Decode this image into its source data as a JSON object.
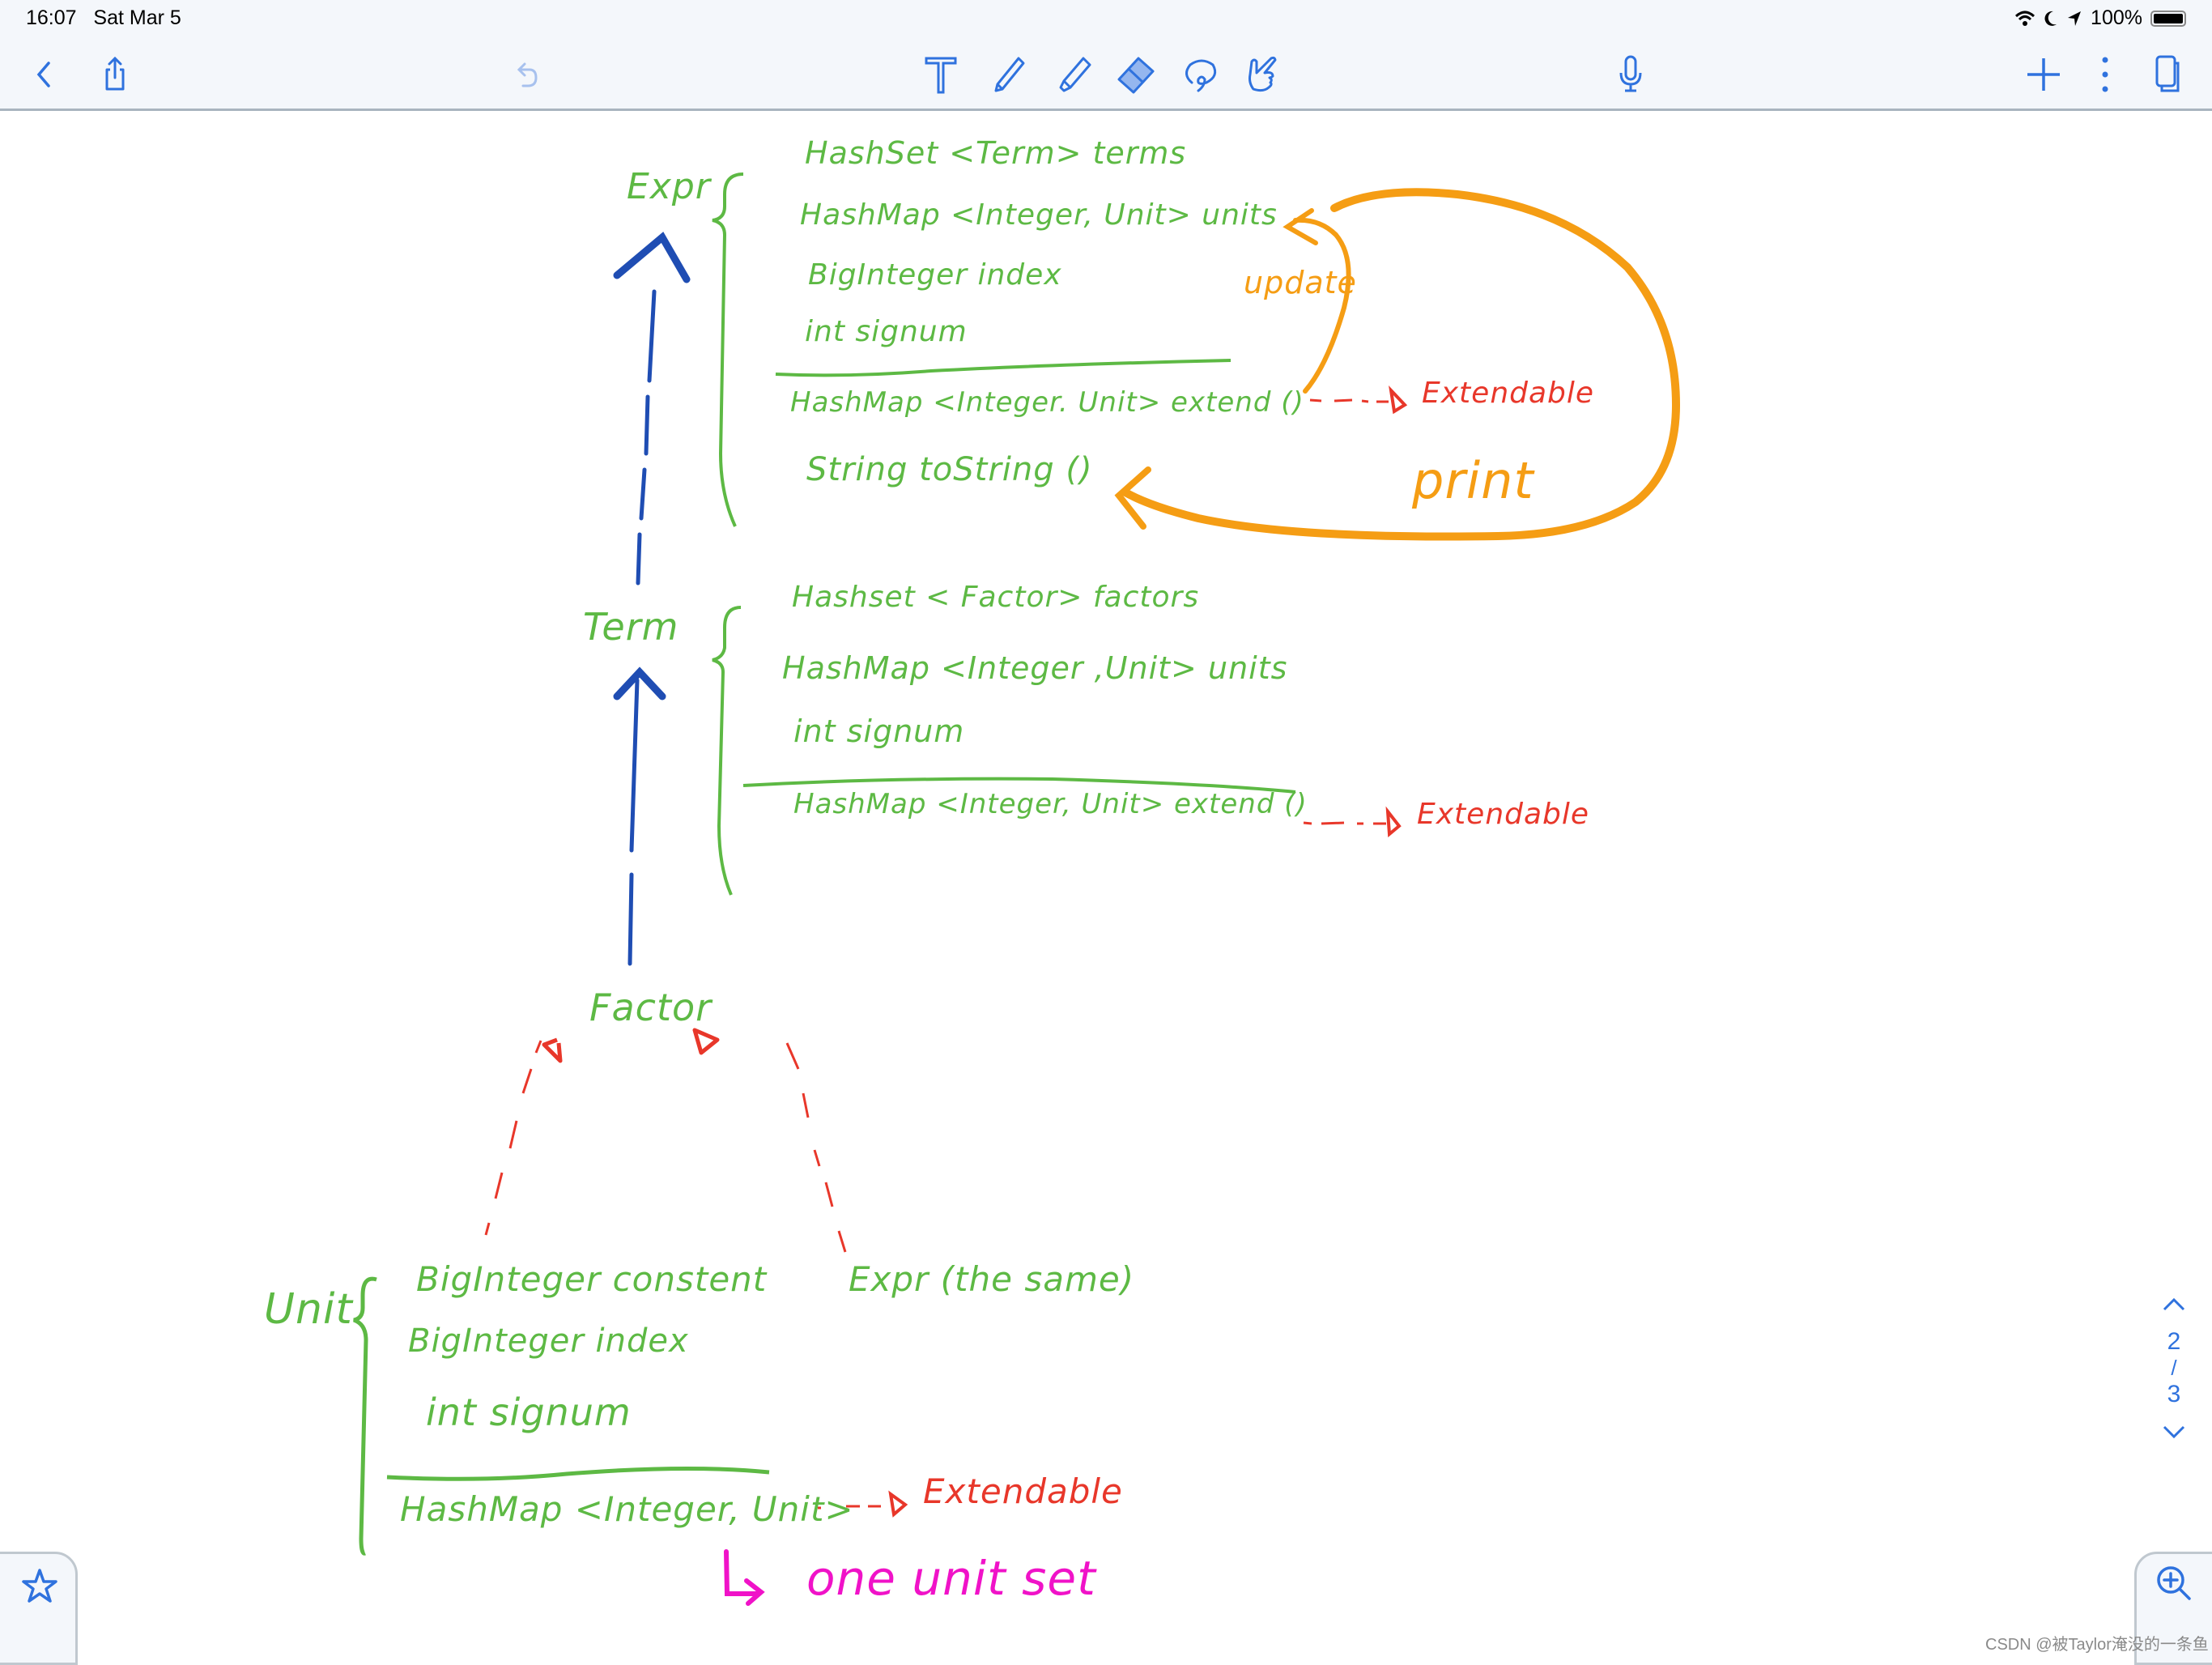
{
  "status_bar": {
    "time": "16:07",
    "date": "Sat Mar 5",
    "battery": "100%",
    "icons": [
      "wifi-icon",
      "moon-icon",
      "location-icon",
      "battery-icon"
    ]
  },
  "toolbar": {
    "left": [
      "back-icon",
      "share-icon",
      "undo-icon"
    ],
    "tools": [
      "text-tool-icon",
      "pen-icon",
      "highlighter-icon",
      "eraser-icon",
      "lasso-icon",
      "hand-icon"
    ],
    "active_tool": "eraser",
    "right": [
      "microphone-icon",
      "add-icon",
      "more-icon",
      "pages-icon"
    ]
  },
  "accent_color": "#2f72de",
  "ink_colors": {
    "green": "#5db944",
    "blue": "#1f4db3",
    "red": "#e8372a",
    "orange": "#f59d14",
    "magenta": "#f012c8"
  },
  "note": {
    "expr": {
      "title": "Expr",
      "fields": [
        "HashSet <Term>  terms",
        "HashMap <Integer, Unit>  units",
        "BigInteger  index",
        "int  signum"
      ],
      "methods": [
        "HashMap <Integer. Unit>   extend ()",
        "String  toString ()"
      ],
      "extends_label": "Extendable"
    },
    "term": {
      "title": "Term",
      "fields": [
        "Hashset < Factor>  factors",
        "HashMap <Integer ,Unit> units",
        "int signum"
      ],
      "methods": [
        "HashMap <Integer, Unit>  extend ()"
      ],
      "extends_label": "Extendable"
    },
    "factor": {
      "title": "Factor"
    },
    "unit": {
      "title": "Unit",
      "fields": [
        "BigInteger   constent",
        "BigInteger    index",
        "int  signum"
      ],
      "methods": [
        "HashMap <Integer, Unit>"
      ],
      "extends_label": "Extendable"
    },
    "expr_same": "Expr (the same)",
    "annotations": {
      "update": "update",
      "print": "print",
      "one_unit_set": "one unit set"
    }
  },
  "pager": {
    "current": "2",
    "separator": "/",
    "total": "3"
  },
  "watermark": "CSDN @被Taylor淹没的一条鱼"
}
